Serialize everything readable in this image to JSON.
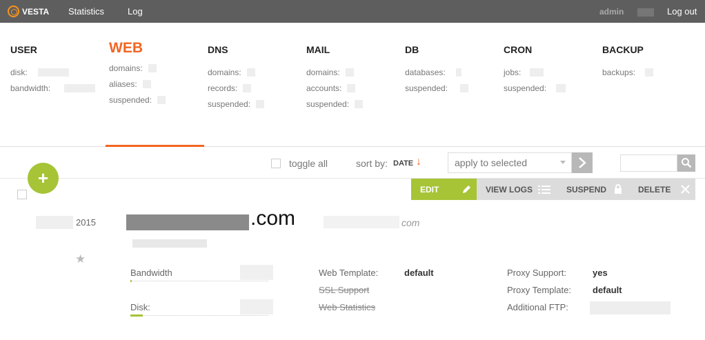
{
  "topbar": {
    "brand": "VESTA",
    "nav": [
      "Statistics",
      "Log"
    ],
    "user": "admin",
    "logout": "Log out"
  },
  "columns": [
    {
      "title": "USER",
      "active": false,
      "rows": [
        "disk:",
        "bandwidth:"
      ]
    },
    {
      "title": "WEB",
      "active": true,
      "rows": [
        "domains:",
        "aliases:",
        "suspended:"
      ]
    },
    {
      "title": "DNS",
      "active": false,
      "rows": [
        "domains:",
        "records:",
        "suspended:"
      ]
    },
    {
      "title": "MAIL",
      "active": false,
      "rows": [
        "domains:",
        "accounts:",
        "suspended:"
      ]
    },
    {
      "title": "DB",
      "active": false,
      "rows": [
        "databases:",
        "suspended:"
      ]
    },
    {
      "title": "CRON",
      "active": false,
      "rows": [
        "jobs:",
        "suspended:"
      ]
    },
    {
      "title": "BACKUP",
      "active": false,
      "rows": [
        "backups:"
      ]
    }
  ],
  "toolbar": {
    "toggle_all": "toggle all",
    "sort_label": "sort by:",
    "sort_value": "DATE",
    "sort_arrow": "↓",
    "select_text": "apply to selected"
  },
  "add_button": "+",
  "actions": {
    "edit": "EDIT",
    "view_logs": "VIEW LOGS",
    "suspend": "SUSPEND",
    "delete": "DELETE"
  },
  "record": {
    "year": "2015",
    "star": "★",
    "domain_suffix": ".com",
    "alias_suffix": "com",
    "bandwidth_label": "Bandwidth",
    "bandwidth_fill": 0.01,
    "disk_label": "Disk:",
    "disk_fill": 0.09,
    "web_template_label": "Web Template:",
    "web_template_value": "default",
    "ssl_support_label": "SSL Support",
    "web_statistics_label": "Web Statistics",
    "proxy_support_label": "Proxy Support:",
    "proxy_support_value": "yes",
    "proxy_template_label": "Proxy Template:",
    "proxy_template_value": "default",
    "additional_ftp_label": "Additional FTP:"
  },
  "colors": {
    "topbar": "#5e5e5e",
    "accent_orange": "#f26522",
    "accent_green": "#a6c436",
    "logo": "#f7941d"
  }
}
